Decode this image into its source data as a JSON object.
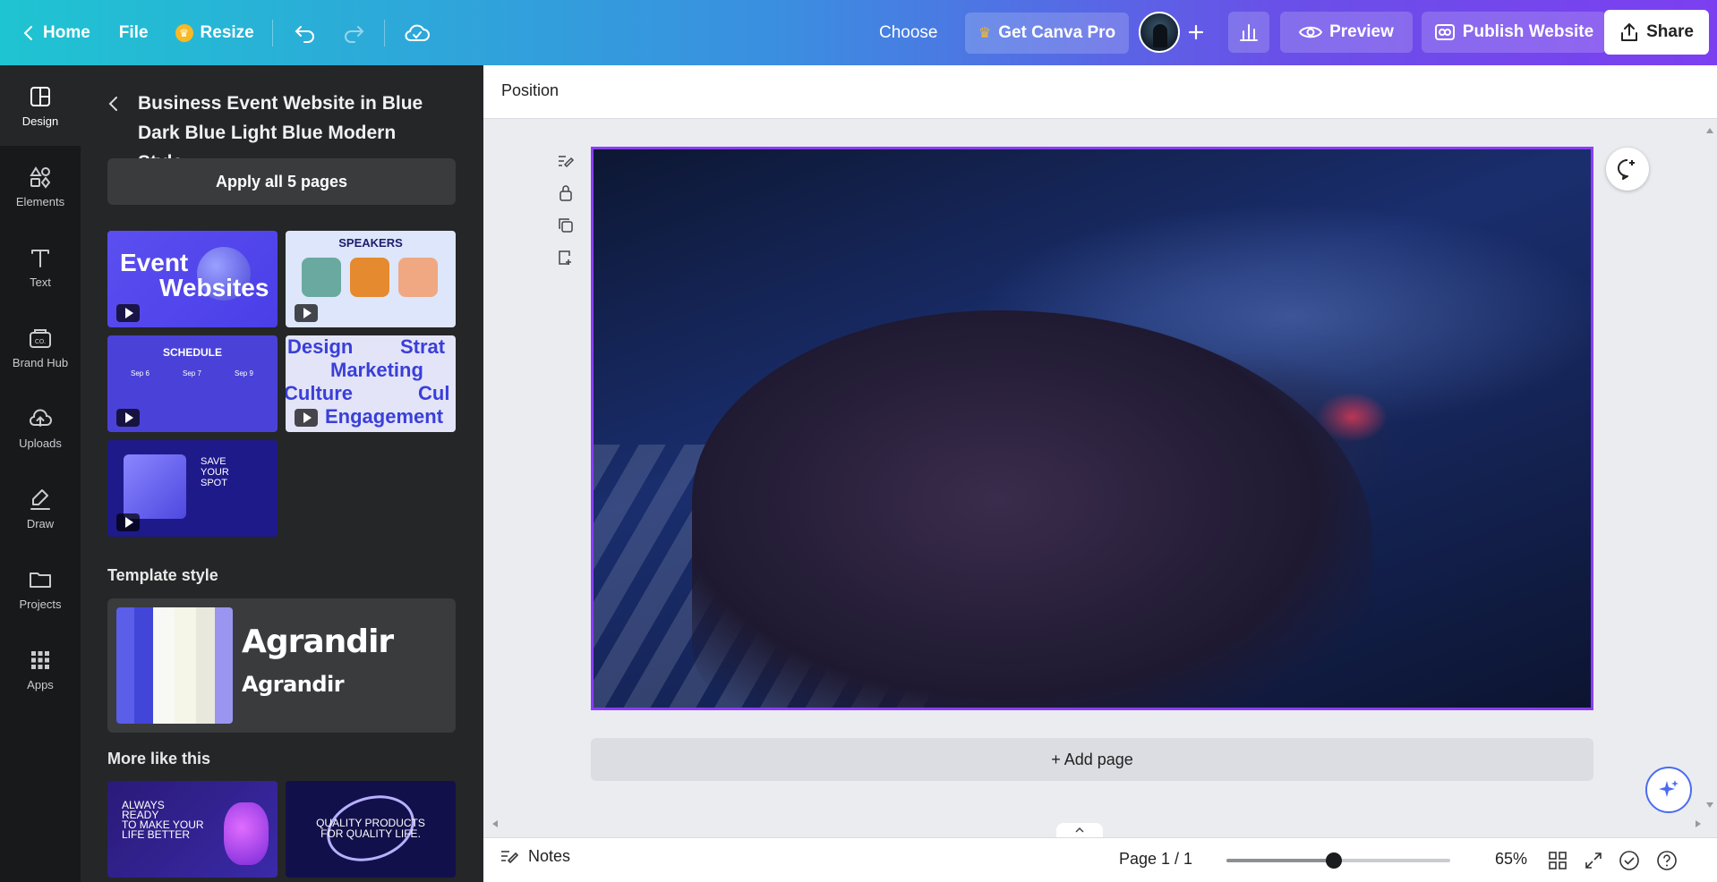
{
  "topbar": {
    "home": "Home",
    "file": "File",
    "resize": "Resize",
    "choose": "Choose",
    "get_pro": "Get Canva Pro",
    "preview": "Preview",
    "publish": "Publish Website",
    "share": "Share"
  },
  "rail": {
    "items": [
      {
        "label": "Design",
        "icon": "design-icon"
      },
      {
        "label": "Elements",
        "icon": "elements-icon"
      },
      {
        "label": "Text",
        "icon": "text-icon"
      },
      {
        "label": "Brand Hub",
        "icon": "brand-hub-icon"
      },
      {
        "label": "Uploads",
        "icon": "uploads-icon"
      },
      {
        "label": "Draw",
        "icon": "draw-icon"
      },
      {
        "label": "Projects",
        "icon": "folder-icon"
      },
      {
        "label": "Apps",
        "icon": "apps-icon"
      }
    ]
  },
  "panel": {
    "title": "Business Event Website in Blue Dark Blue Light Blue Modern Style",
    "apply_all": "Apply all 5 pages",
    "thumbs": {
      "t1_line1": "Event",
      "t1_line2": "Websites",
      "t2_title": "SPEAKERS",
      "t3_title": "SCHEDULE",
      "t3_dates": [
        "Sep 6",
        "Sep 7",
        "Sep 9"
      ],
      "t4_words": [
        "Design",
        "Strat",
        "Marketing",
        "Culture",
        "Cul",
        "Engagement"
      ],
      "t5_lines": [
        "SAVE",
        "YOUR",
        "SPOT"
      ]
    },
    "template_style_label": "Template style",
    "style_font_heading": "Agrandir",
    "style_font_body": "Agrandir",
    "style_swatches": [
      "#5a5ee8",
      "#4146d8",
      "#f8f8f4",
      "#f5f5e8",
      "#e8e8dc",
      "#9a96f0"
    ],
    "more_like_this": "More like this",
    "more_1": [
      "ALWAYS",
      "READY",
      "TO MAKE YOUR",
      "LIFE BETTER"
    ],
    "more_2": [
      "QUALITY PRODUCTS",
      "FOR QUALITY LIFE."
    ]
  },
  "canvas": {
    "position_label": "Position",
    "add_page": "+ Add page"
  },
  "bottombar": {
    "notes": "Notes",
    "page_indicator": "Page 1 / 1",
    "zoom_value": "65%",
    "zoom_fraction": 0.48
  },
  "colors": {
    "accent_purple": "#8b3dff",
    "panel_bg": "#252627",
    "rail_bg": "#18191b"
  }
}
